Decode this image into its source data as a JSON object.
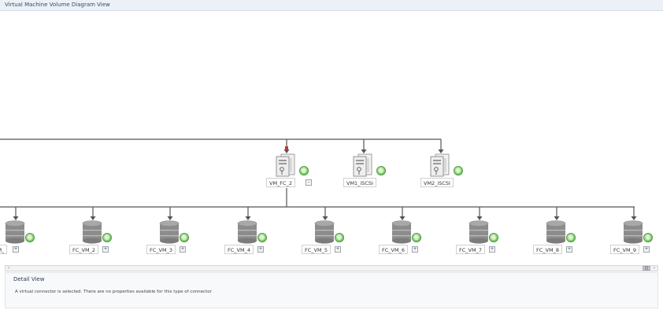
{
  "window": {
    "title": "Virtual Machine Volume Diagram View"
  },
  "diagram": {
    "virtual_machines": [
      {
        "name": "VM_FC_2",
        "status": "healthy",
        "has_expander": true
      },
      {
        "name": "VM1_iSCSI",
        "status": "healthy",
        "has_expander": false
      },
      {
        "name": "VM2_iSCSI",
        "status": "healthy",
        "has_expander": false
      }
    ],
    "expander_symbol": "–",
    "disk_expander_symbol": "+",
    "volumes": [
      {
        "name": "VM_"
      },
      {
        "name": "FC_VM_2"
      },
      {
        "name": "FC_VM_3"
      },
      {
        "name": "FC_VM_4"
      },
      {
        "name": "FC_VM_5"
      },
      {
        "name": "FC_VM_6"
      },
      {
        "name": "FC_VM_7"
      },
      {
        "name": "FC_VM_8"
      },
      {
        "name": "FC_VM_9"
      }
    ],
    "colors": {
      "connector": "#555555",
      "vm_body": "#eeeeee",
      "disk_body": "#8c8c8c",
      "status_ok": "#7cc766"
    },
    "selected_connector_marker_color": "#d32f2f"
  },
  "scrollbar": {
    "left_arrow": "‹",
    "right_arrow": "›",
    "thumb_glyph": "|||"
  },
  "detail_view": {
    "title": "Detail View",
    "message": "A virtual connector is selected. There are no properties available for this type of connector"
  }
}
